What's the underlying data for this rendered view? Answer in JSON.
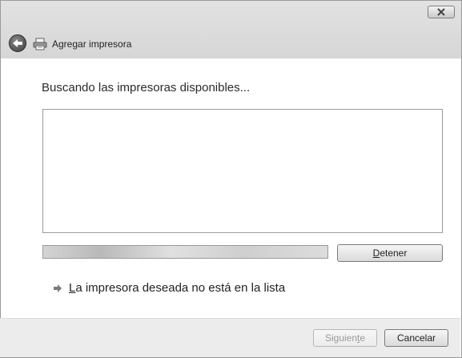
{
  "window": {
    "title": "Agregar impresora"
  },
  "content": {
    "heading": "Buscando las impresoras disponibles...",
    "printer_list": [],
    "progress": {
      "indeterminate": true
    },
    "stop_button": {
      "label_pre": "",
      "label_mnemonic": "D",
      "label_post": "etener"
    },
    "not_listed_link": {
      "label_mnemonic": "L",
      "label_post": "a impresora deseada no está en la lista"
    }
  },
  "footer": {
    "next_button": {
      "label_pre": "Siguien",
      "label_mnemonic": "t",
      "label_post": "e",
      "enabled": false
    },
    "cancel_button": {
      "label": "Cancelar"
    }
  },
  "icons": {
    "close": "close-icon",
    "back": "back-arrow-icon",
    "printer": "printer-icon",
    "link_arrow": "arrow-right-icon"
  }
}
